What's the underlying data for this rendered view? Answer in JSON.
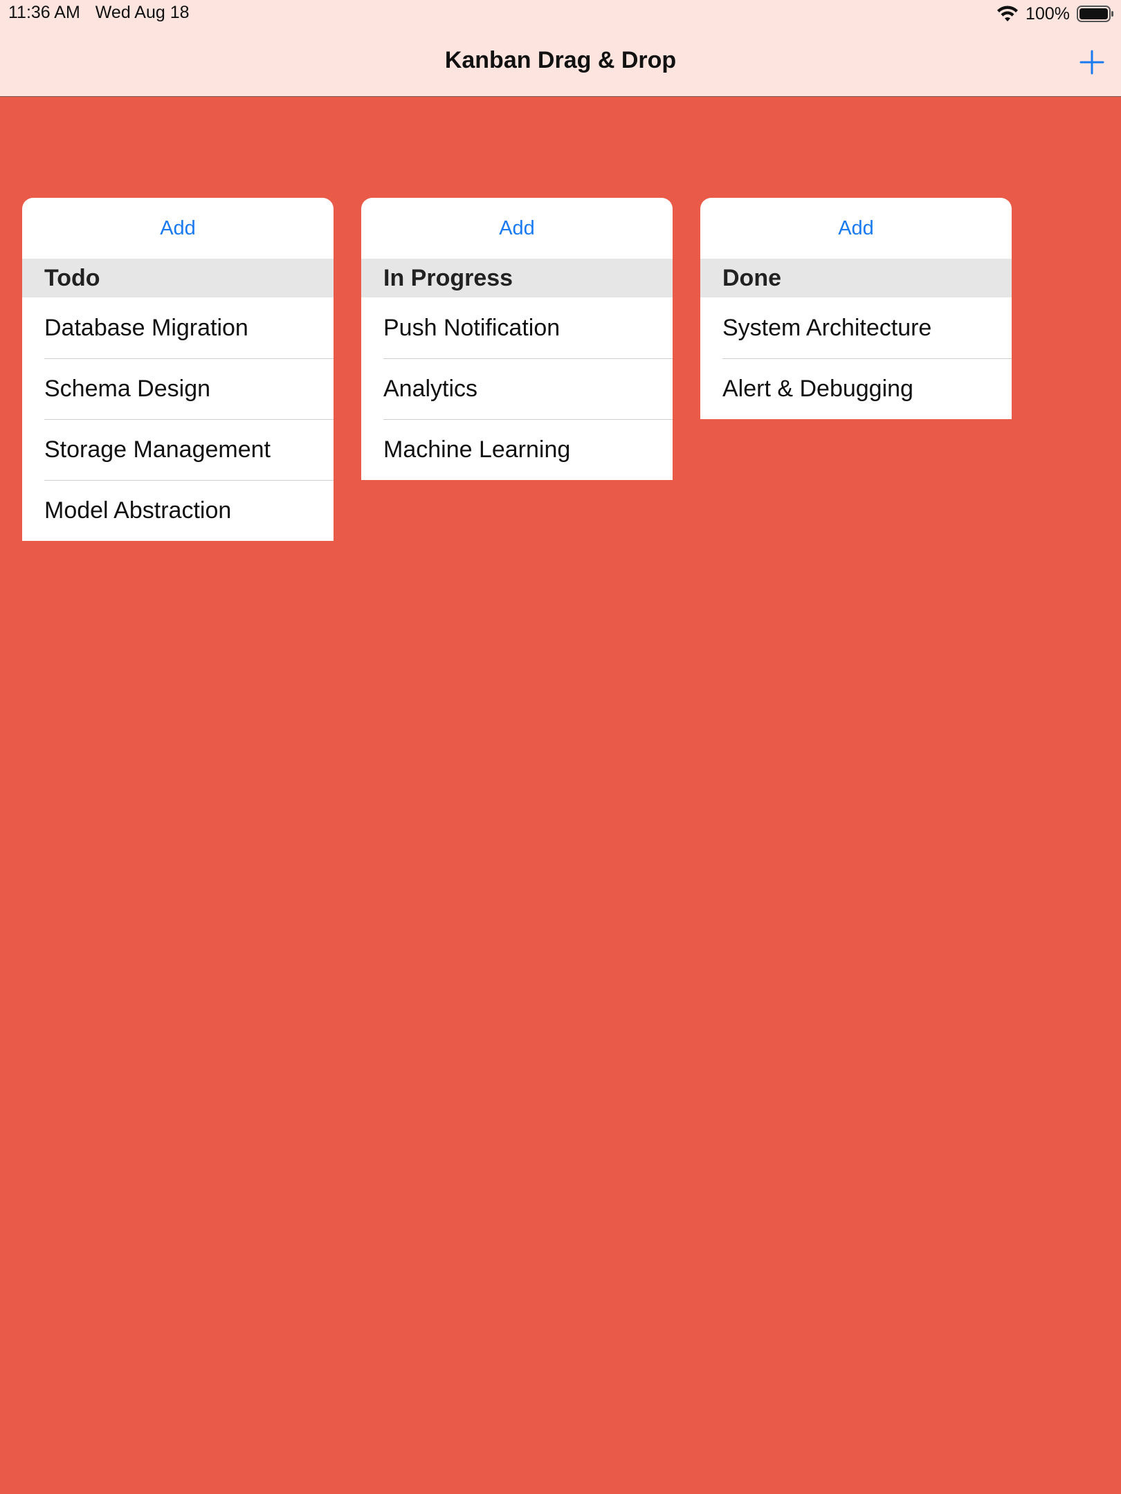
{
  "status_bar": {
    "time": "11:36 AM",
    "date": "Wed Aug 18",
    "battery": "100%",
    "icons": [
      "wifi-icon",
      "battery-icon"
    ]
  },
  "nav": {
    "title": "Kanban Drag & Drop",
    "add_icon": "plus-icon"
  },
  "colors": {
    "background": "#ea5a48",
    "bar": "#fde4df",
    "accent": "#1a7bf0",
    "header_bg": "#e6e6e6"
  },
  "columns": [
    {
      "add_label": "Add",
      "title": "Todo",
      "cards": [
        "Database Migration",
        "Schema Design",
        "Storage Management",
        "Model Abstraction"
      ]
    },
    {
      "add_label": "Add",
      "title": "In Progress",
      "cards": [
        "Push Notification",
        "Analytics",
        "Machine Learning"
      ]
    },
    {
      "add_label": "Add",
      "title": "Done",
      "cards": [
        "System Architecture",
        "Alert & Debugging"
      ]
    }
  ]
}
